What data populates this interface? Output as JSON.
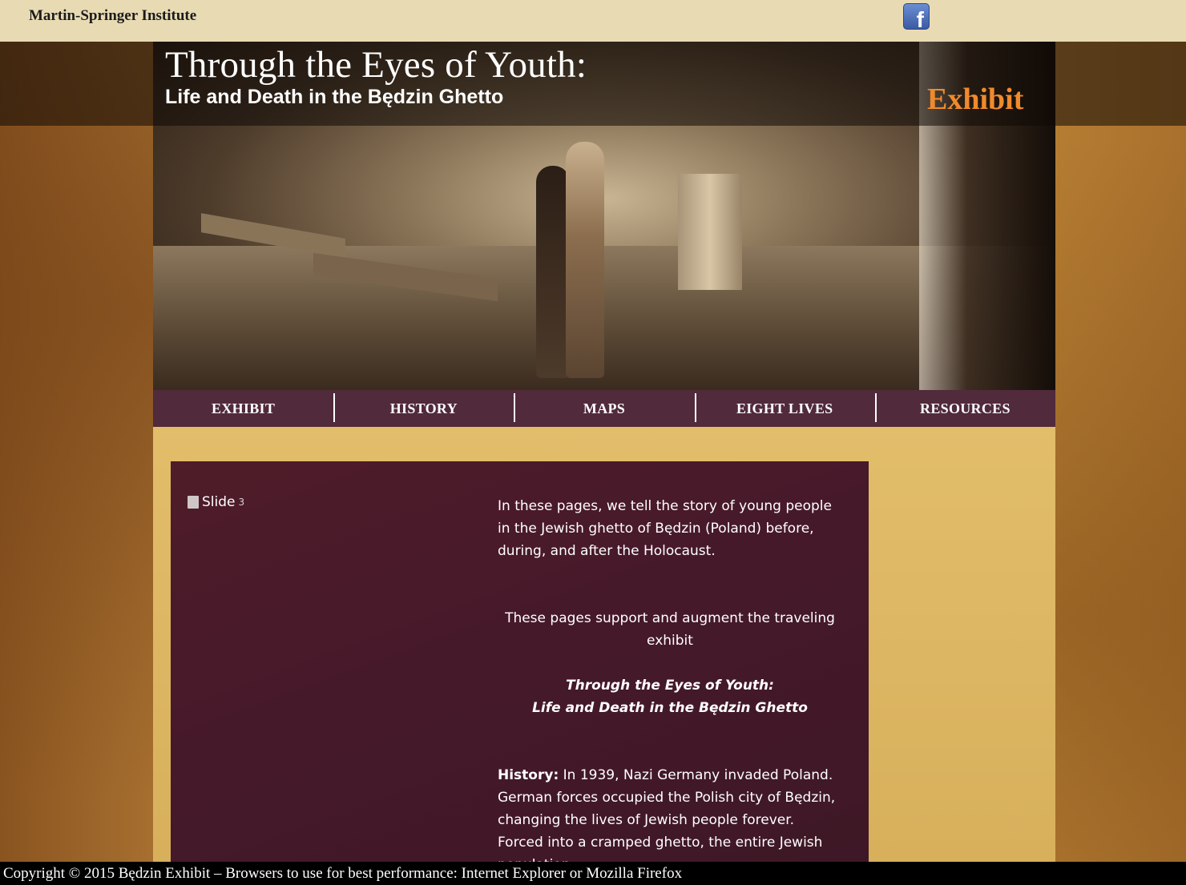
{
  "topbar": {
    "site_name": "Martin-Springer Institute",
    "facebook_icon": "facebook-icon",
    "facebook_glyph": "f"
  },
  "header": {
    "title": "Through the Eyes of Youth:",
    "subtitle": "Life and Death in the Będzin Ghetto",
    "section_label": "Exhibit"
  },
  "nav": {
    "items": [
      {
        "label": "EXHIBIT"
      },
      {
        "label": "HISTORY"
      },
      {
        "label": "MAPS"
      },
      {
        "label": "EIGHT LIVES"
      },
      {
        "label": "RESOURCES"
      }
    ]
  },
  "content": {
    "slide_alt": "Slide",
    "slide_suffix": "3",
    "intro": "In these pages, we tell the story of young people in the Jewish ghetto of Będzin (Poland) before, during, and after the Holocaust.",
    "support": "These pages support and augment the traveling exhibit",
    "exhibit_title_line1": "Through the Eyes of Youth:",
    "exhibit_title_line2": "Life and Death in the Będzin Ghetto",
    "history_label": "History:",
    "history_text": " In 1939, Nazi Germany invaded Poland. German forces occupied the Polish city of Będzin, changing the lives of Jewish people forever. Forced into a cramped ghetto, the entire Jewish population"
  },
  "footer": {
    "text": "Copyright © 2015 Będzin Exhibit – Browsers to use for best performance: Internet Explorer or Mozilla Firefox"
  },
  "colors": {
    "nav_bg": "#512a3b",
    "content_box_bg": "#46192a",
    "section_label": "#ef8a2c",
    "topbar_bg": "#e8dbb4"
  }
}
